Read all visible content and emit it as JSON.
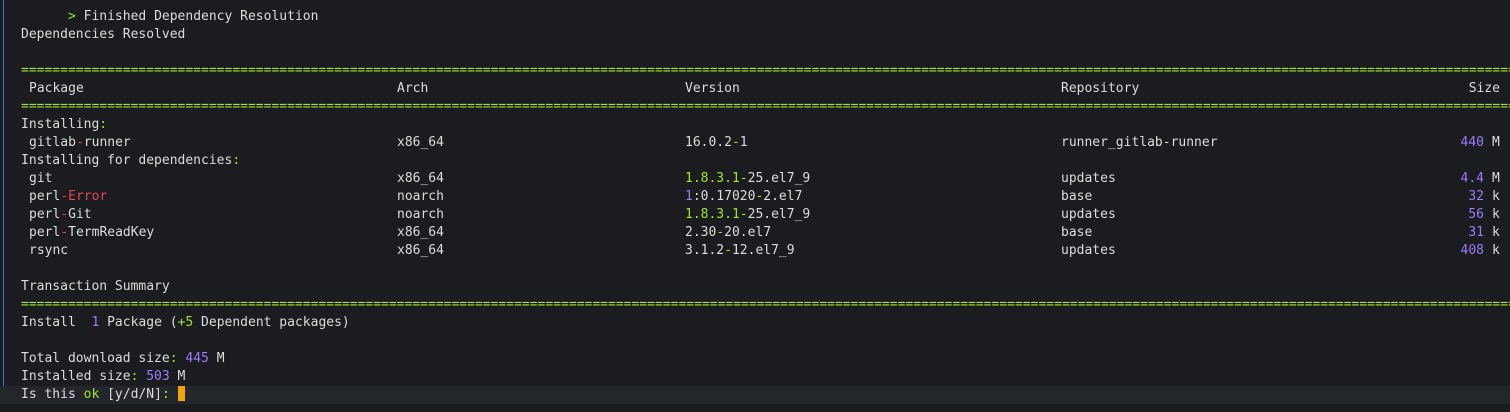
{
  "terminal": {
    "lines": {
      "finished": "  > Finished Dependency Resolution",
      "resolved": "Dependencies Resolved",
      "installing": "Installing",
      "installing_colon": ":",
      "installing_deps": "Installing for dependencies",
      "installing_deps_colon": ":",
      "summary": "Transaction Summary",
      "install_word": "Install",
      "install_count": "1",
      "install_pkg": "Package (",
      "install_plus": "+5",
      "install_dep": " Dependent packages)",
      "total_label": "Total download size",
      "total_colon": ":",
      "total_value": "445",
      "total_unit": "M",
      "installed_label": "Installed size",
      "installed_colon": ":",
      "installed_value": "503",
      "installed_unit": "M",
      "prompt_pre": "Is this ",
      "prompt_ok": "ok",
      "prompt_opts": " [y/d/N]",
      "prompt_colon": ": "
    },
    "separator": "==============================================================================================================================================================================================================================",
    "table": {
      "headers": {
        "package": "Package",
        "arch": "Arch",
        "version": "Version",
        "repository": "Repository",
        "size": "Size"
      },
      "main_rows": [
        {
          "package_a": "gitlab",
          "package_sep": "-",
          "package_b": "runner",
          "arch": "x86_64",
          "version_a": "16.0.2",
          "version_sep": "-",
          "version_b": "1",
          "repository": "runner_gitlab-runner",
          "size_num": "440",
          "size_unit": "M"
        }
      ],
      "dep_rows": [
        {
          "package": "git",
          "arch": "x86_64",
          "version": "1.8.3.1-25.el7_9",
          "repository": "updates",
          "size_num": "4.4",
          "size_unit": "M"
        },
        {
          "package": "perl-Error",
          "arch": "noarch",
          "version": "1:0.17020-2.el7",
          "repository": "base",
          "size_num": "32",
          "size_unit": "k"
        },
        {
          "package": "perl-Git",
          "arch": "noarch",
          "version": "1.8.3.1-25.el7_9",
          "repository": "updates",
          "size_num": "56",
          "size_unit": "k"
        },
        {
          "package": "perl-TermReadKey",
          "arch": "x86_64",
          "version": "2.30-20.el7",
          "repository": "base",
          "size_num": "31",
          "size_unit": "k"
        },
        {
          "package": "rsync",
          "arch": "x86_64",
          "version": "3.1.2-12.el7_9",
          "repository": "updates",
          "size_num": "408",
          "size_unit": "k"
        }
      ]
    },
    "colors": {
      "background": "#1a1c1f",
      "text": "#dcdcdc",
      "green": "#a6e22e",
      "purple": "#9b7cf4",
      "red": "#e0455c",
      "cursor": "#f0a30a",
      "gutter": "#3a78c4"
    }
  }
}
